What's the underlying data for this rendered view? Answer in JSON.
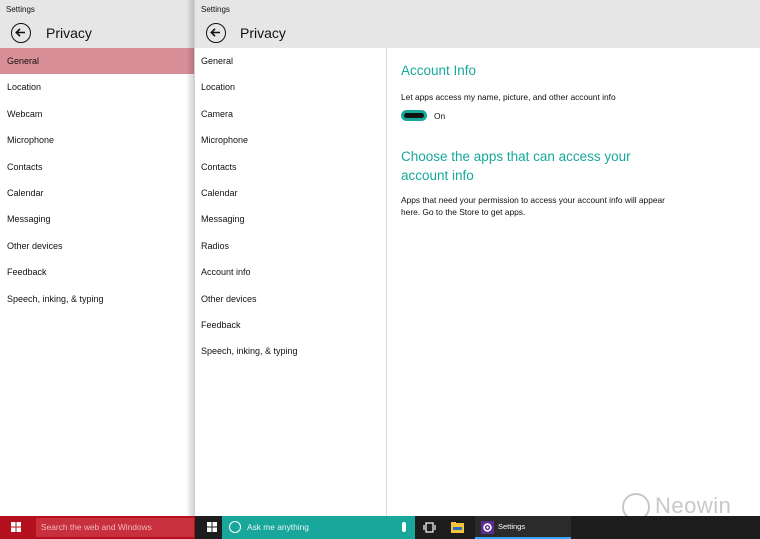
{
  "left_window": {
    "title": "Settings",
    "header": "Privacy",
    "nav": [
      "General",
      "Location",
      "Webcam",
      "Microphone",
      "Contacts",
      "Calendar",
      "Messaging",
      "Other devices",
      "Feedback",
      "Speech, inking, & typing"
    ],
    "selected_index": 0
  },
  "right_window": {
    "title": "Settings",
    "header": "Privacy",
    "nav": [
      "General",
      "Location",
      "Camera",
      "Microphone",
      "Contacts",
      "Calendar",
      "Messaging",
      "Radios",
      "Account info",
      "Other devices",
      "Feedback",
      "Speech, inking, & typing"
    ],
    "section1_title": "Account Info",
    "section1_desc": "Let apps access my name, picture, and other account info",
    "toggle_state": "On",
    "section2_title": "Choose the apps that can access your account info",
    "section2_desc": "Apps that need your permission to access your account info will appear here. Go to the Store to get apps."
  },
  "taskbar": {
    "left_search_placeholder": "Search the web and Windows",
    "cortana_placeholder": "Ask me anything",
    "settings_app_label": "Settings"
  },
  "watermark": {
    "text": "Neowin"
  },
  "colors": {
    "accent": "#18a89b",
    "selected_nav": "#d98f98",
    "taskbar_left": "#b5101d",
    "cortana_box": "#1aa79b"
  },
  "icons": {
    "back": "back-arrow-icon",
    "start": "windows-logo-icon",
    "cortana": "cortana-circle-icon",
    "mic": "microphone-icon",
    "task_view": "task-view-icon",
    "explorer": "file-explorer-icon",
    "settings": "gear-icon"
  }
}
